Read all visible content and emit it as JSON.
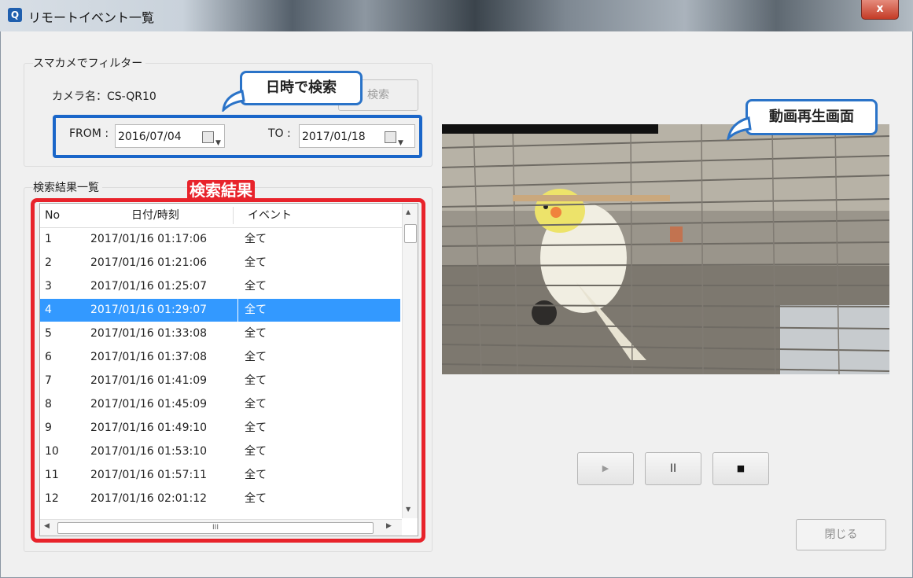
{
  "window": {
    "title": "リモートイベント一覧",
    "close_glyph": "x",
    "app_icon": "app-logo-icon"
  },
  "filter": {
    "group_label": "スマカメでフィルター",
    "camera_label": "カメラ名：",
    "camera_name": "CS-QR10",
    "search_button": "検索",
    "from_label": "FROM :",
    "from_date": "2016/07/04",
    "to_label": "TO :",
    "to_date": "2017/01/18"
  },
  "callouts": {
    "search_by_datetime": "日時で検索",
    "video_playback": "動画再生画面",
    "search_results": "検索結果"
  },
  "results": {
    "group_label": "検索結果一覧",
    "columns": [
      "No",
      "日付/時刻",
      "イベント"
    ],
    "selected_index": 3,
    "rows": [
      {
        "no": "1",
        "datetime": "2017/01/16 01:17:06",
        "event": "全て"
      },
      {
        "no": "2",
        "datetime": "2017/01/16 01:21:06",
        "event": "全て"
      },
      {
        "no": "3",
        "datetime": "2017/01/16 01:25:07",
        "event": "全て"
      },
      {
        "no": "4",
        "datetime": "2017/01/16 01:29:07",
        "event": "全て"
      },
      {
        "no": "5",
        "datetime": "2017/01/16 01:33:08",
        "event": "全て"
      },
      {
        "no": "6",
        "datetime": "2017/01/16 01:37:08",
        "event": "全て"
      },
      {
        "no": "7",
        "datetime": "2017/01/16 01:41:09",
        "event": "全て"
      },
      {
        "no": "8",
        "datetime": "2017/01/16 01:45:09",
        "event": "全て"
      },
      {
        "no": "9",
        "datetime": "2017/01/16 01:49:10",
        "event": "全て"
      },
      {
        "no": "10",
        "datetime": "2017/01/16 01:53:10",
        "event": "全て"
      },
      {
        "no": "11",
        "datetime": "2017/01/16 01:57:11",
        "event": "全て"
      },
      {
        "no": "12",
        "datetime": "2017/01/16 02:01:12",
        "event": "全て"
      }
    ],
    "hscroll_grip": "III"
  },
  "player": {
    "play_glyph": "▶",
    "pause_glyph": "II",
    "stop_glyph": "■"
  },
  "close_button": "閉じる",
  "colors": {
    "highlight_blue": "#1a66c9",
    "highlight_red": "#e8232b",
    "selection": "#3399ff"
  }
}
